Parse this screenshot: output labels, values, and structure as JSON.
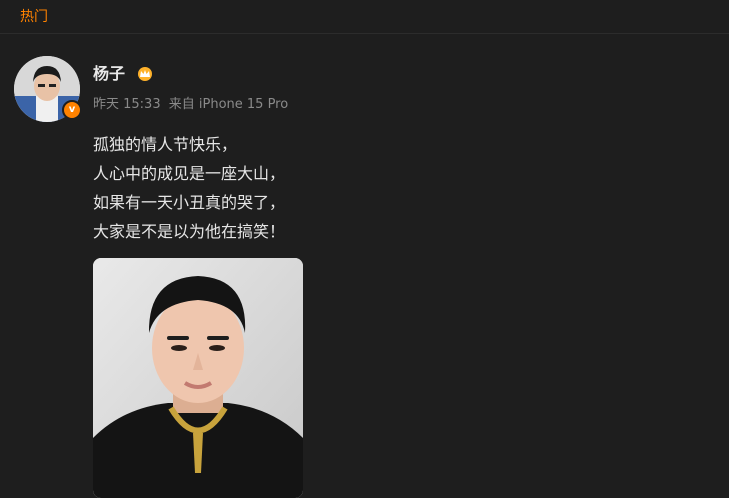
{
  "tabs": {
    "hot_label": "热门"
  },
  "post": {
    "author": "杨子",
    "meta": {
      "time": "昨天 15:33",
      "source": "来自 iPhone 15 Pro"
    },
    "lines": [
      "孤独的情人节快乐，",
      "人心中的成见是一座大山，",
      "如果有一天小丑真的哭了，",
      "大家是不是以为他在搞笑！"
    ],
    "avatar_icon": "verified-v-icon",
    "crown_icon": "crown-icon"
  },
  "colors": {
    "accent": "#ff8200",
    "background": "#1e1e1e",
    "text": "#e6e6e6",
    "meta": "#8a8a8a"
  }
}
